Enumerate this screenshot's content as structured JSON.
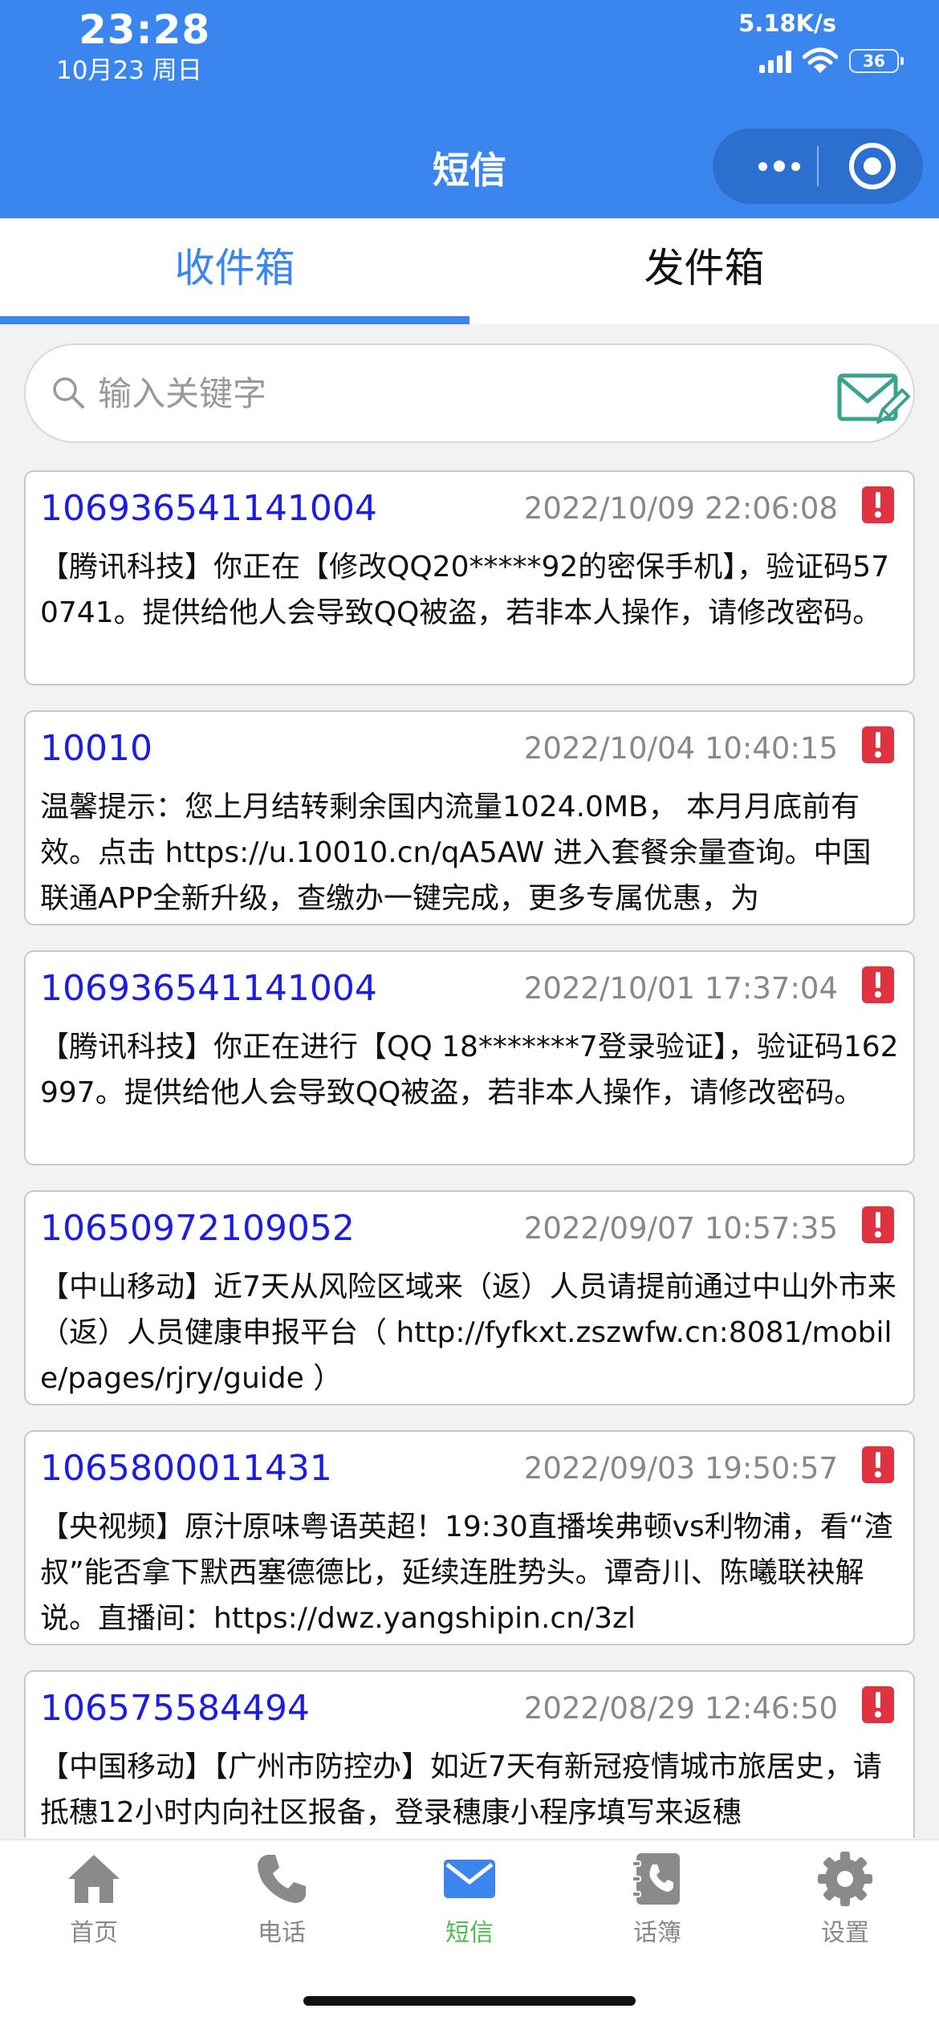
{
  "status_bar": {
    "time": "23:28",
    "date": "10月23 周日",
    "net_speed": "5.18K/s",
    "battery": "36"
  },
  "nav": {
    "title": "短信"
  },
  "tabs": {
    "inbox": "收件箱",
    "outbox": "发件箱",
    "active": "inbox"
  },
  "search": {
    "placeholder": "输入关键字",
    "value": ""
  },
  "messages": [
    {
      "sender": "106936541141004",
      "time": "2022/10/09 22:06:08",
      "body": "【腾讯科技】你正在【修改QQ20*****92的密保手机】，验证码570741。提供给他人会导致QQ被盗，若非本人操作，请修改密码。"
    },
    {
      "sender": "10010",
      "time": "2022/10/04 10:40:15",
      "body": "温馨提示：您上月结转剩余国内流量1024.0MB， 本月月底前有效。点击 https://u.10010.cn/qA5AW 进入套餐余量查询。中国联通APP全新升级，查缴办一键完成，更多专属优惠，为"
    },
    {
      "sender": "106936541141004",
      "time": "2022/10/01 17:37:04",
      "body": "【腾讯科技】你正在进行【QQ 18*******7登录验证】，验证码162997。提供给他人会导致QQ被盗，若非本人操作，请修改密码。"
    },
    {
      "sender": "10650972109052",
      "time": "2022/09/07 10:57:35",
      "body": "【中山移动】近7天从风险区域来（返）人员请提前通过中山外市来（返）人员健康申报平台（ http://fyfkxt.zszwfw.cn:8081/mobile/pages/rjry/guide ）"
    },
    {
      "sender": "1065800011431",
      "time": "2022/09/03 19:50:57",
      "body": "【央视频】原汁原味粤语英超！19:30直播埃弗顿vs利物浦，看“渣叔”能否拿下默西塞德德比，延续连胜势头。谭奇川、陈曦联袂解说。直播间：https://dwz.yangshipin.cn/3zl"
    },
    {
      "sender": "106575584494",
      "time": "2022/08/29 12:46:50",
      "body": "【中国移动】【广州市防控办】如近7天有新冠疫情城市旅居史，请抵穗12小时内向社区报备，登录穗康小程序填写来返穗"
    }
  ],
  "tabbar": [
    {
      "label": "首页",
      "icon": "home-icon",
      "active": false
    },
    {
      "label": "电话",
      "icon": "phone-icon",
      "active": false
    },
    {
      "label": "短信",
      "icon": "mail-icon",
      "active": true
    },
    {
      "label": "话簿",
      "icon": "contacts-icon",
      "active": false
    },
    {
      "label": "设置",
      "icon": "gear-icon",
      "active": false
    }
  ],
  "colors": {
    "header_blue": "#3a86ee",
    "sender_blue": "#1d1de0",
    "flag_red": "#e03341",
    "active_tab_green": "#4fbd4f",
    "compose_teal": "#3aa38c"
  }
}
